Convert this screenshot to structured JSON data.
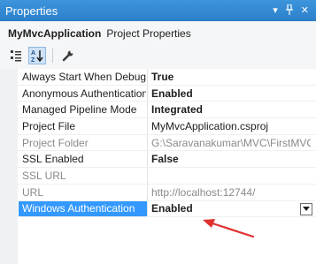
{
  "window": {
    "title": "Properties",
    "controls": {
      "dropdown": "▾",
      "pin": "📌",
      "close": "✕"
    }
  },
  "object_selector": {
    "name": "MyMvcApplication",
    "type": "Project Properties"
  },
  "toolbar": {
    "categorized_icon": "categorized-icon",
    "alphabetical_icon": "alphabetical-icon",
    "property_pages_icon": "wrench-icon"
  },
  "properties": [
    {
      "name": "Always Start When Debugging",
      "value": "True"
    },
    {
      "name": "Anonymous Authentication",
      "value": "Enabled"
    },
    {
      "name": "Managed Pipeline Mode",
      "value": "Integrated"
    },
    {
      "name": "Project File",
      "value": "MyMvcApplication.csproj"
    },
    {
      "name": "Project Folder",
      "value": "G:\\Saravanakumar\\MVC\\FirstMVCApplication"
    },
    {
      "name": "SSL Enabled",
      "value": "False"
    },
    {
      "name": "SSL URL",
      "value": ""
    },
    {
      "name": "URL",
      "value": "http://localhost:12744/"
    },
    {
      "name": "Windows Authentication",
      "value": "Enabled"
    }
  ],
  "colors": {
    "titlebar": "#2b7fc9",
    "selection": "#3399ff",
    "annotation_arrow": "#e03030"
  }
}
